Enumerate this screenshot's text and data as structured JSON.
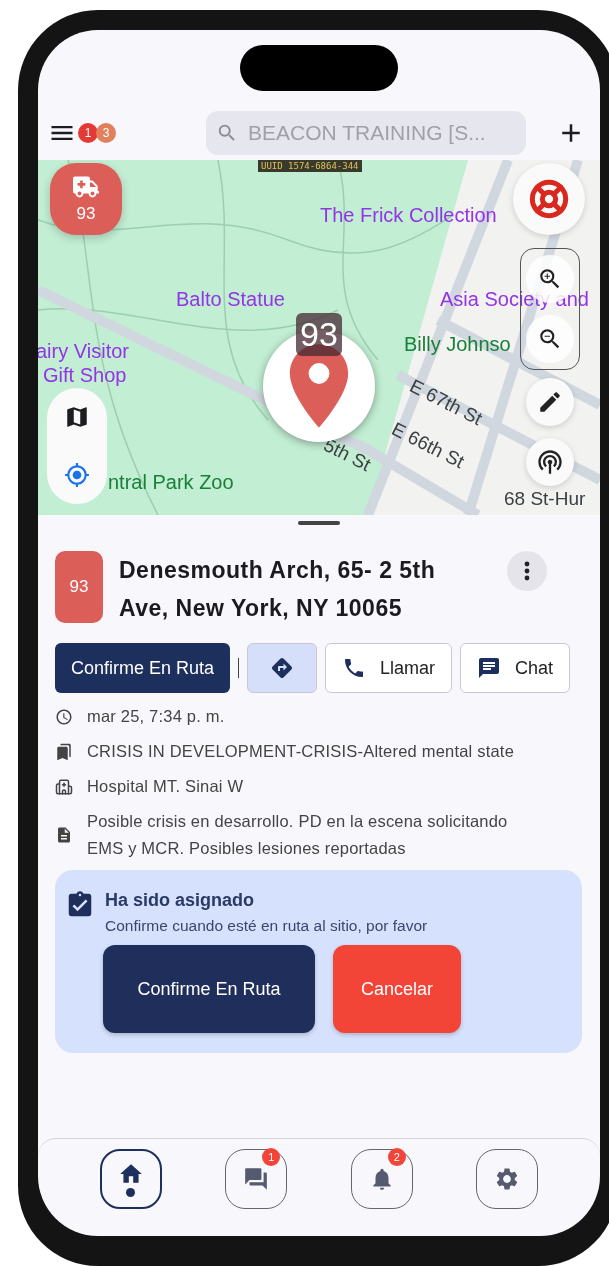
{
  "top_bar": {
    "menu_badges": [
      {
        "text": "1",
        "color": "#e53935"
      },
      {
        "text": "3",
        "color": "#e0805c"
      }
    ],
    "search": {
      "placeholder": "BEACON TRAINING [S..."
    }
  },
  "map": {
    "uuid_label": "UUID 1574-6864-344",
    "unit_badge": "93",
    "marker_label": "93",
    "labels": [
      {
        "text": "The Frick Collection",
        "kind": "poi"
      },
      {
        "text": "Balto Statue",
        "kind": "poi"
      },
      {
        "text": "Asia Society and",
        "kind": "poi"
      },
      {
        "text": "airy Visitor",
        "kind": "poi"
      },
      {
        "text": "Billy Johnso",
        "kind": "park"
      },
      {
        "text": "Gift Shop",
        "kind": "poi"
      },
      {
        "text": "E 67th St",
        "kind": "street"
      },
      {
        "text": "E 66th St",
        "kind": "street"
      },
      {
        "text": "5th St",
        "kind": "street"
      },
      {
        "text": "ntral Park Zoo",
        "kind": "park"
      },
      {
        "text": "68 St-Hur",
        "kind": "street"
      }
    ]
  },
  "incident": {
    "unit": "93",
    "address": "Denesmouth Arch, 65- 2 5th Ave, New York, NY 10065",
    "actions": [
      {
        "kind": "primary",
        "label": "Confirme En Ruta"
      },
      {
        "kind": "directions"
      },
      {
        "kind": "call",
        "label": "Llamar"
      },
      {
        "kind": "chat",
        "label": "Chat"
      }
    ],
    "details": [
      {
        "kind": "time",
        "text": "mar 25, 7:34 p. m."
      },
      {
        "kind": "type",
        "text": "CRISIS IN DEVELOPMENT-CRISIS-Altered mental state"
      },
      {
        "kind": "hospital",
        "text": "Hospital MT. Sinai W"
      },
      {
        "kind": "notes",
        "text": "Posible crisis en desarrollo. PD en la escena solicitando EMS y MCR. Posibles lesiones reportadas"
      }
    ]
  },
  "assignment": {
    "title": "Ha sido asignado",
    "message": "Confirme cuando esté en ruta al sitio, por favor",
    "buttons": [
      {
        "kind": "confirm",
        "label": "Confirme En Ruta"
      },
      {
        "kind": "cancel",
        "label": "Cancelar"
      }
    ]
  },
  "bottom_nav": [
    {
      "kind": "home",
      "selected": true
    },
    {
      "kind": "messages",
      "selected": false,
      "badge": "1"
    },
    {
      "kind": "alerts",
      "selected": false,
      "badge": "2"
    },
    {
      "kind": "settings",
      "selected": false
    }
  ]
}
